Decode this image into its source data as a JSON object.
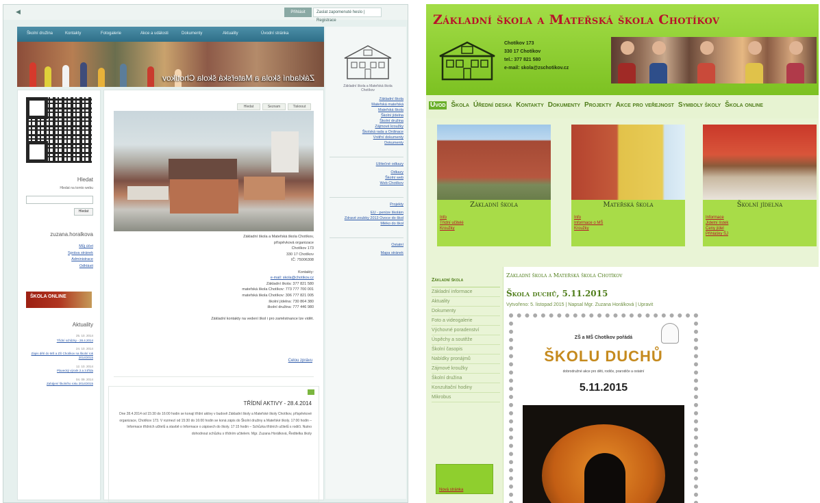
{
  "left": {
    "topbar": {
      "login_label": "Přihlásit",
      "links": "Zaslat zapomenuté heslo | Registrace"
    },
    "nav": [
      "Úvodní stránka",
      "Aktuality",
      "Dokumenty",
      "Akce a události",
      "Fotogalerie",
      "Kontakty",
      "Školní družina"
    ],
    "banner_title": "Základní škola a Mateřská škola Chotíkov",
    "logo_caption": "Základní škola a Mateřská škola Chotíkov",
    "menu": [
      "Základní škola",
      "Mateřská mateřská",
      "Mateřská škola",
      "Školní jídelna",
      "Školní družina",
      "Zájmové kroužky",
      "Školská rada a Ordinace",
      "Vnitřní dokumenty",
      "Dokumenty"
    ],
    "section_odkazy": "Užitečné odkazy",
    "odkazy": [
      "Odkazy",
      "Školní web",
      "Web Chotíkov"
    ],
    "section_projekty": "Projekty",
    "projekty": [
      "EU - peníze školám",
      "Zdravé zoubky 2013 Ovoce do škol",
      "Mléko do škol"
    ],
    "section_ostatni": "Ostatní",
    "ostatni": [
      "Mapa stránek"
    ],
    "tabs": [
      "Tisknout",
      "Seznam",
      "Hledat"
    ],
    "address_lines": [
      "Základní škola a Mateřská škola Chotíkov,",
      "příspěvková organizace",
      "Chotíkov 173",
      "330 17 Chotíkov",
      "IČ: 75006308",
      "",
      "Kontakty:",
      "e-mail: skola@chotikov.cz",
      "Základní škola: 377 821 580",
      "mateřská škola Chotíkov: 773 777 700 001",
      "mateřská škola Chotíkov: 306 777 821 005",
      "školní jídelna: 730 864 380",
      "školní družina: 777 446 980",
      "",
      "Základní kontakty na vedení škol i pro zaměstnance lze vidět."
    ],
    "read_more": "Celou zprávu",
    "article2_title": "TŘÍDNÍ AKTIVY - 28.4.2014",
    "article2_text": "Dne 28.4.2014 od 15:30 do 16:00 hodin se konají třídní aktivy v budově Základní školy a Mateřské školy Chotíkov, příspěvkové organizace, Chotíkov 173. V rozmezí od 15:30 do 16:00 hodin se koná zápis do Školní družiny a Mateřské školy. 17:00 hodin – Informace třídních učitelů a stavbě o Informace o zápisech do školy. 17:15 hodin – Schůzka třídních učitelů s rodiči. Nutno dohodnout schůzku s třídním učitelem. Mgr. Zuzana Horálková, Ředitelka školy",
    "search_title": "Hledat",
    "search_hint": "Hledat na tomto webu",
    "search_btn": "Hledat",
    "user_name": "zuzana.horalkova",
    "user_links": [
      "Můj účet",
      "Správa stránek",
      "Administrace",
      "Odhlásit"
    ],
    "skola_badge": "ŠKOLA ONLINE",
    "news_title": "Aktuality",
    "news": [
      {
        "d": "25. 10. 2014",
        "t": "Třídní schůzky - 28.4.2014"
      },
      {
        "d": "24. 10. 2014",
        "t": "Zápis dětí do MŠ a ZŠ Chotíkov na školní rok 2014/2015"
      },
      {
        "d": "12. 10. 2014",
        "t": "Plavecký výcvik 2.a 3.třída"
      },
      {
        "d": "04. 09. 2014",
        "t": "Zahájení školního roku 2014/2015"
      }
    ]
  },
  "right": {
    "site_title": "Základní škola a Mateřská škola Chotíkov",
    "info_lines": [
      "Chotíkov 173",
      "330 17 Chotíkov",
      "tel.: 377 821 580",
      "e-mail: skola@zschotikov.cz"
    ],
    "nav": [
      "Úvod",
      "Škola",
      "Úřední deska",
      "Kontakty",
      "Dokumenty",
      "Projekty",
      "Akce pro veřejnost",
      "Symboly školy",
      "Škola online"
    ],
    "cards": [
      {
        "title": "Základní škola",
        "links": [
          "Info",
          "Třídní učitelé",
          "Kroužky"
        ]
      },
      {
        "title": "Mateřská škola",
        "links": [
          "Info",
          "Informace o MŠ",
          "Kroužky"
        ]
      },
      {
        "title": "Školní jídelna",
        "links": [
          "Informace",
          "Jídelní lístek",
          "Ceny jídel",
          "Přihlášky ŠJ"
        ]
      }
    ],
    "sidebar_heading": "Základní škola",
    "sidebar_items": [
      "Základní informace",
      "Aktuality",
      "Dokumenty",
      "Foto a videogalerie",
      "Výchovné poradenství",
      "Úspěchy a soutěže",
      "Školní časopis",
      "Nabídky pronájmů",
      "Zájmové kroužky",
      "Školní družina",
      "Konzultační hodiny",
      "Mikrobus"
    ],
    "promo_link": "Nová stránka",
    "breadcrumb": "Základní škola a Mateřská škola Chotíkov",
    "page_title": "Škola duchů, 5.11.2015",
    "meta": "Vytvořeno: 5. listopad 2015 | Napsal Mgr. Zuzana Horálková | Upravit",
    "poster": {
      "line1": "ZŠ a MŠ Chotíkov pořádá",
      "line2": "ŠKOLU DUCHŮ",
      "line3": "dobrodružné akce pro děti, rodiče, prarodiče a ostatní",
      "line4": "5.11.2015"
    }
  },
  "colors": {
    "right_header_green": "#8ccd2f",
    "right_title_red": "#b8122a",
    "left_nav_blue": "#3b7f98",
    "link_blue": "#2b58a8"
  }
}
